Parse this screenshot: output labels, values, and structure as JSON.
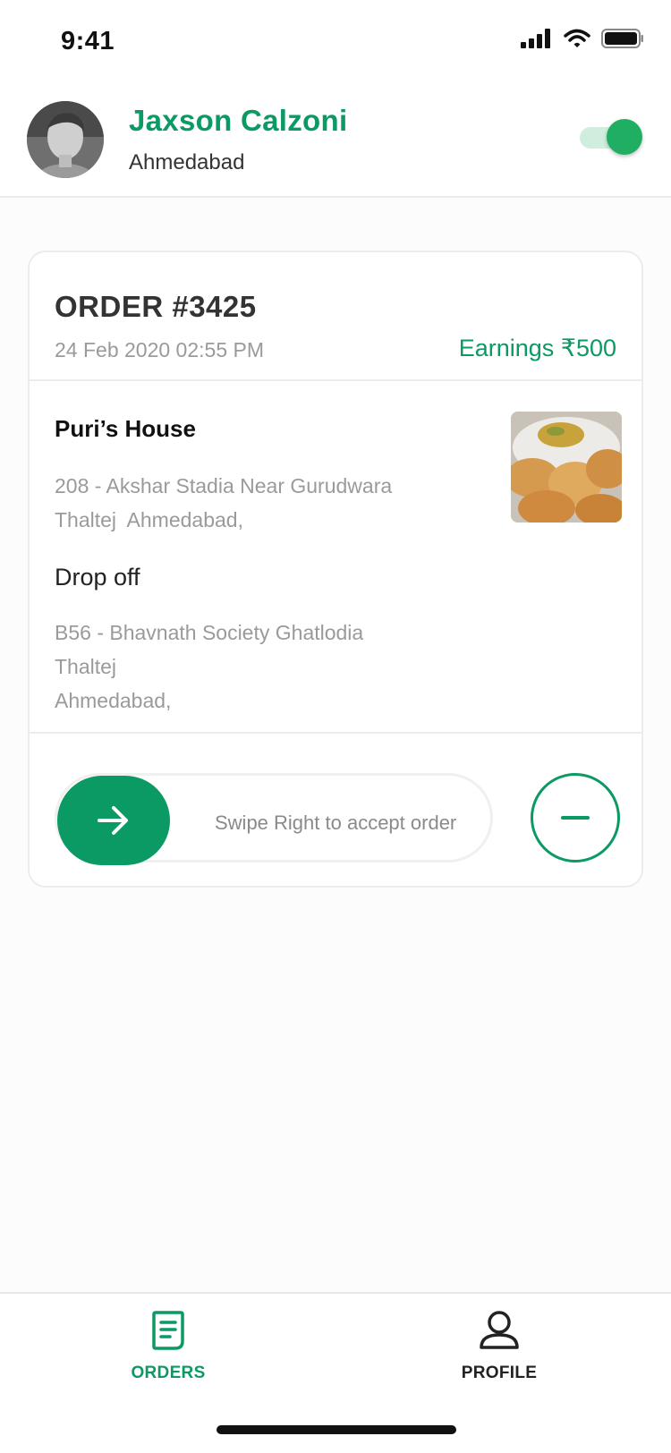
{
  "status_bar": {
    "time": "9:41",
    "icons": [
      "cellular-signal-icon",
      "wifi-icon",
      "battery-icon"
    ]
  },
  "header": {
    "user_name": "Jaxson Calzoni",
    "city": "Ahmedabad",
    "online_toggle_on": true
  },
  "order": {
    "title": "ORDER #3425",
    "date": "24 Feb 2020 02:55 PM",
    "earnings": "Earnings ₹500",
    "restaurant_name": "Puri’s House",
    "restaurant_address_line1": "208 - Akshar Stadia Near Gurudwara",
    "restaurant_address_line2": "Thaltej  Ahmedabad,",
    "dropoff_label": "Drop off",
    "dropoff_address_line1": "B56 - Bhavnath Society Ghatlodia",
    "dropoff_address_line2": "Thaltej",
    "dropoff_address_line3": "Ahmedabad,",
    "swipe_label": "Swipe Right to accept order"
  },
  "tab_bar": {
    "orders_label": "ORDERS",
    "profile_label": "PROFILE",
    "active_tab": "orders"
  },
  "colors": {
    "accent": "#0b9a63",
    "toggle_knob": "#1fae62",
    "muted_text": "#9a9a9a"
  }
}
